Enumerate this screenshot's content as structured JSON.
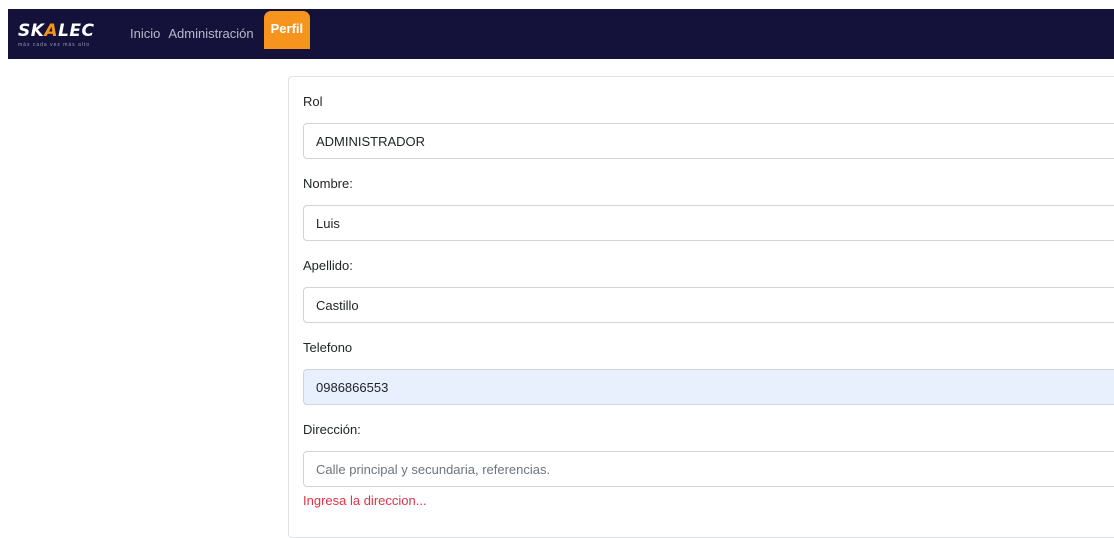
{
  "nav": {
    "brand": {
      "part1": "SK",
      "part2": "A",
      "part3": "LEC",
      "tagline": "más cada vez más alto"
    },
    "links": [
      {
        "label": "Inicio"
      },
      {
        "label": "Administración"
      },
      {
        "label": "Perfil"
      }
    ]
  },
  "form": {
    "rol": {
      "label": "Rol",
      "value": "ADMINISTRADOR"
    },
    "nombre": {
      "label": "Nombre:",
      "value": "Luis"
    },
    "apellido": {
      "label": "Apellido:",
      "value": "Castillo"
    },
    "telefono": {
      "label": "Telefono",
      "value": "0986866553"
    },
    "direccion": {
      "label": "Dirección:",
      "value": "",
      "placeholder": "Calle principal y secundaria, referencias.",
      "error": "Ingresa la direccion..."
    }
  },
  "colors": {
    "navbar": "#14123a",
    "accent": "#f7941d",
    "error": "#dc3545",
    "autofill": "#e8f0fe"
  }
}
